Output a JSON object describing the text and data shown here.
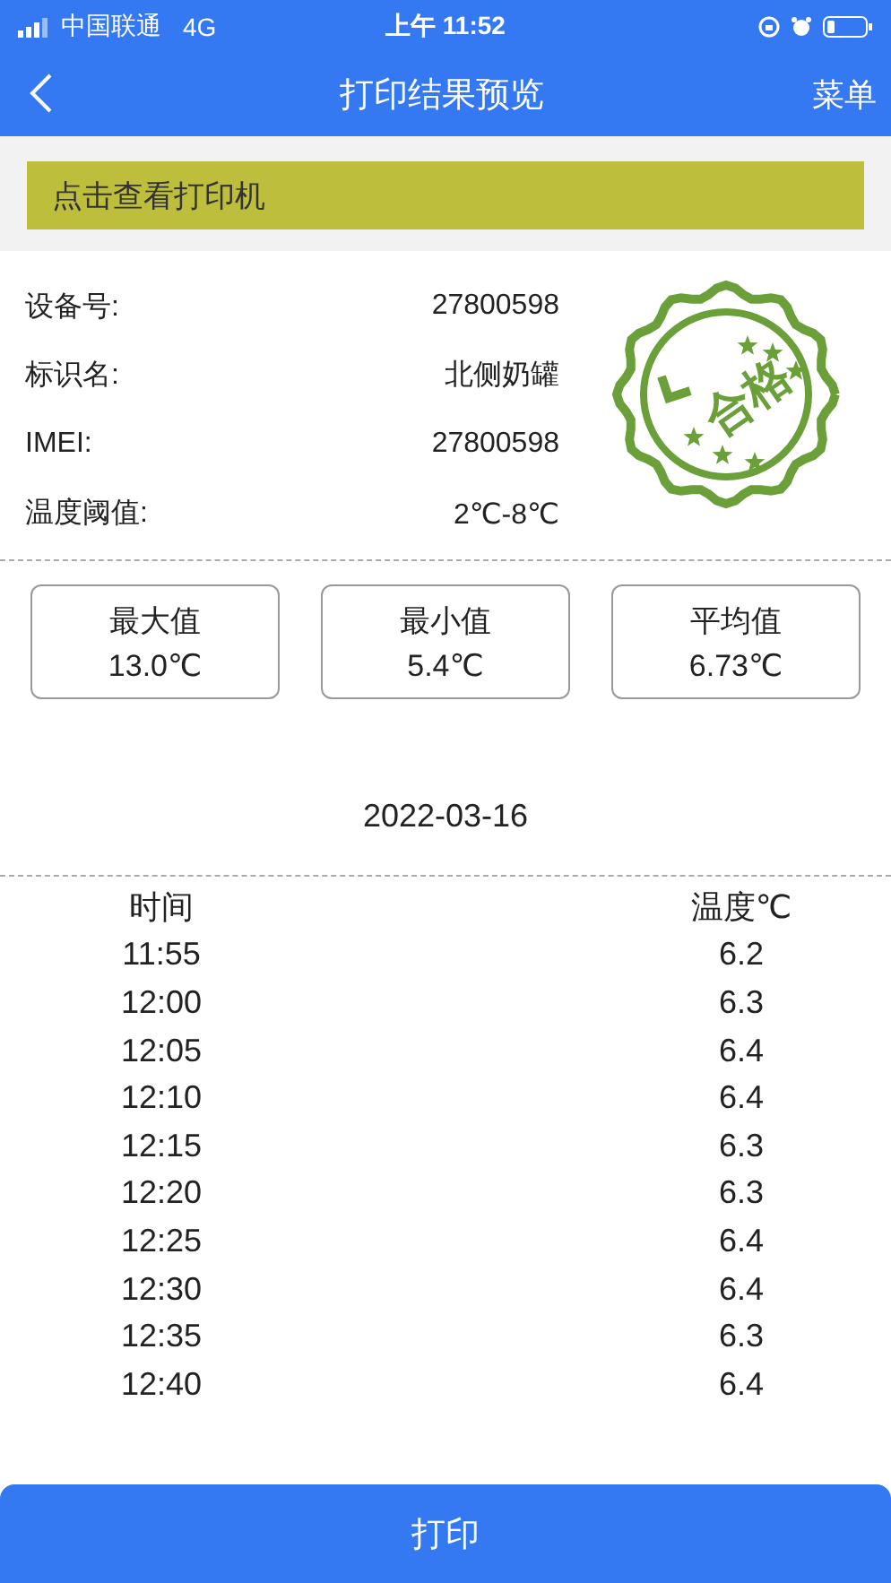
{
  "status_bar": {
    "carrier": "中国联通",
    "network": "4G",
    "time": "上午 11:52"
  },
  "nav": {
    "title": "打印结果预览",
    "menu": "菜单"
  },
  "printer_bar": {
    "label": "点击查看打印机"
  },
  "info": [
    {
      "label": "设备号:",
      "value": "27800598"
    },
    {
      "label": "标识名:",
      "value": "北侧奶罐"
    },
    {
      "label": "IMEI:",
      "value": "27800598"
    },
    {
      "label": "温度阈值:",
      "value": "2℃-8℃"
    }
  ],
  "stamp": {
    "label": "合格"
  },
  "stats": [
    {
      "label": "最大值",
      "value": "13.0℃"
    },
    {
      "label": "最小值",
      "value": "5.4℃"
    },
    {
      "label": "平均值",
      "value": "6.73℃"
    }
  ],
  "date": "2022-03-16",
  "table": {
    "columns": [
      "时间",
      "温度℃"
    ],
    "rows": [
      [
        "11:55",
        "6.2"
      ],
      [
        "12:00",
        "6.3"
      ],
      [
        "12:05",
        "6.4"
      ],
      [
        "12:10",
        "6.4"
      ],
      [
        "12:15",
        "6.3"
      ],
      [
        "12:20",
        "6.3"
      ],
      [
        "12:25",
        "6.4"
      ],
      [
        "12:30",
        "6.4"
      ],
      [
        "12:35",
        "6.3"
      ],
      [
        "12:40",
        "6.4"
      ]
    ]
  },
  "print_button": "打印"
}
